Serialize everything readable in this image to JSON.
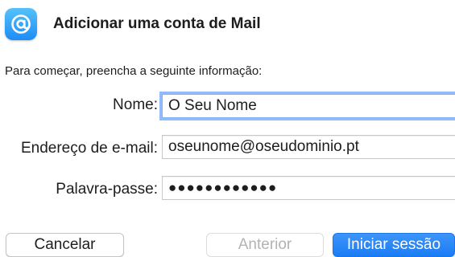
{
  "header": {
    "app_icon": "at-sign-icon",
    "title": "Adicionar uma conta de Mail"
  },
  "intro": {
    "text": "Para começar, preencha a seguinte informação:"
  },
  "form": {
    "name_label": "Nome:",
    "name_value": "O Seu Nome",
    "email_label": "Endereço de e-mail:",
    "email_value": "oseunome@oseudominio.pt",
    "password_label": "Palavra-passe:",
    "password_masked": "●●●●●●●●●●●●",
    "password_length": 12
  },
  "buttons": {
    "cancel_label": "Cancelar",
    "previous_label": "Anterior",
    "previous_enabled": false,
    "signin_label": "Iniciar sessão"
  },
  "colors": {
    "accent": "#1a7cf5",
    "focus_ring": "#3884f6",
    "disabled_text": "#b3b3b3"
  }
}
